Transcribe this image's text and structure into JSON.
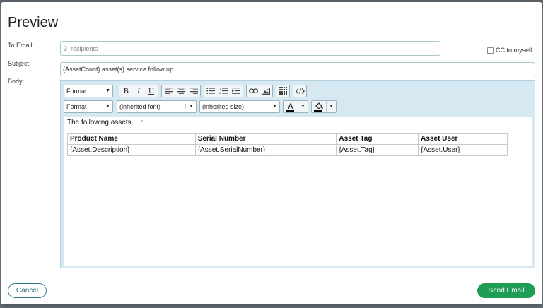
{
  "modal": {
    "title": "Preview",
    "to": {
      "label": "To Email:",
      "value": "3_recipients"
    },
    "cc": {
      "label": "CC to myself",
      "checked": false
    },
    "subject": {
      "label": "Subject:",
      "value": "{AssetCount} asset(s) service follow up"
    },
    "body_label": "Body:"
  },
  "toolbar": {
    "row1": {
      "format": "Format"
    },
    "row2": {
      "format": "Format",
      "font": "(inherited font)",
      "size": "(inherited size)"
    },
    "icons": [
      "bold-icon",
      "italic-icon",
      "underline-icon",
      "align-left-icon",
      "align-center-icon",
      "align-right-icon",
      "bulleted-list-icon",
      "numbered-list-icon",
      "indent-icon",
      "link-icon",
      "image-icon",
      "table-icon",
      "source-code-icon",
      "text-color-icon",
      "background-color-icon"
    ],
    "bold": "B",
    "italic": "I",
    "underline": "U",
    "text_color_glyph": "A",
    "text_color": "#000000"
  },
  "body": {
    "intro": "The following assets ... :",
    "table": {
      "headers": [
        "Product Name",
        "Serial Number",
        "Asset Tag",
        "Asset User"
      ],
      "rows": [
        [
          "{Asset.Description}",
          "{Asset.SerialNumber}",
          "{Asset.Tag}",
          "{Asset.User}"
        ]
      ]
    }
  },
  "actions": {
    "cancel": "Cancel",
    "send": "Send Email"
  },
  "colors": {
    "send": "#1f9d55",
    "cancel_border": "#2f7a8f",
    "editor_bg": "#d6e8f1"
  }
}
